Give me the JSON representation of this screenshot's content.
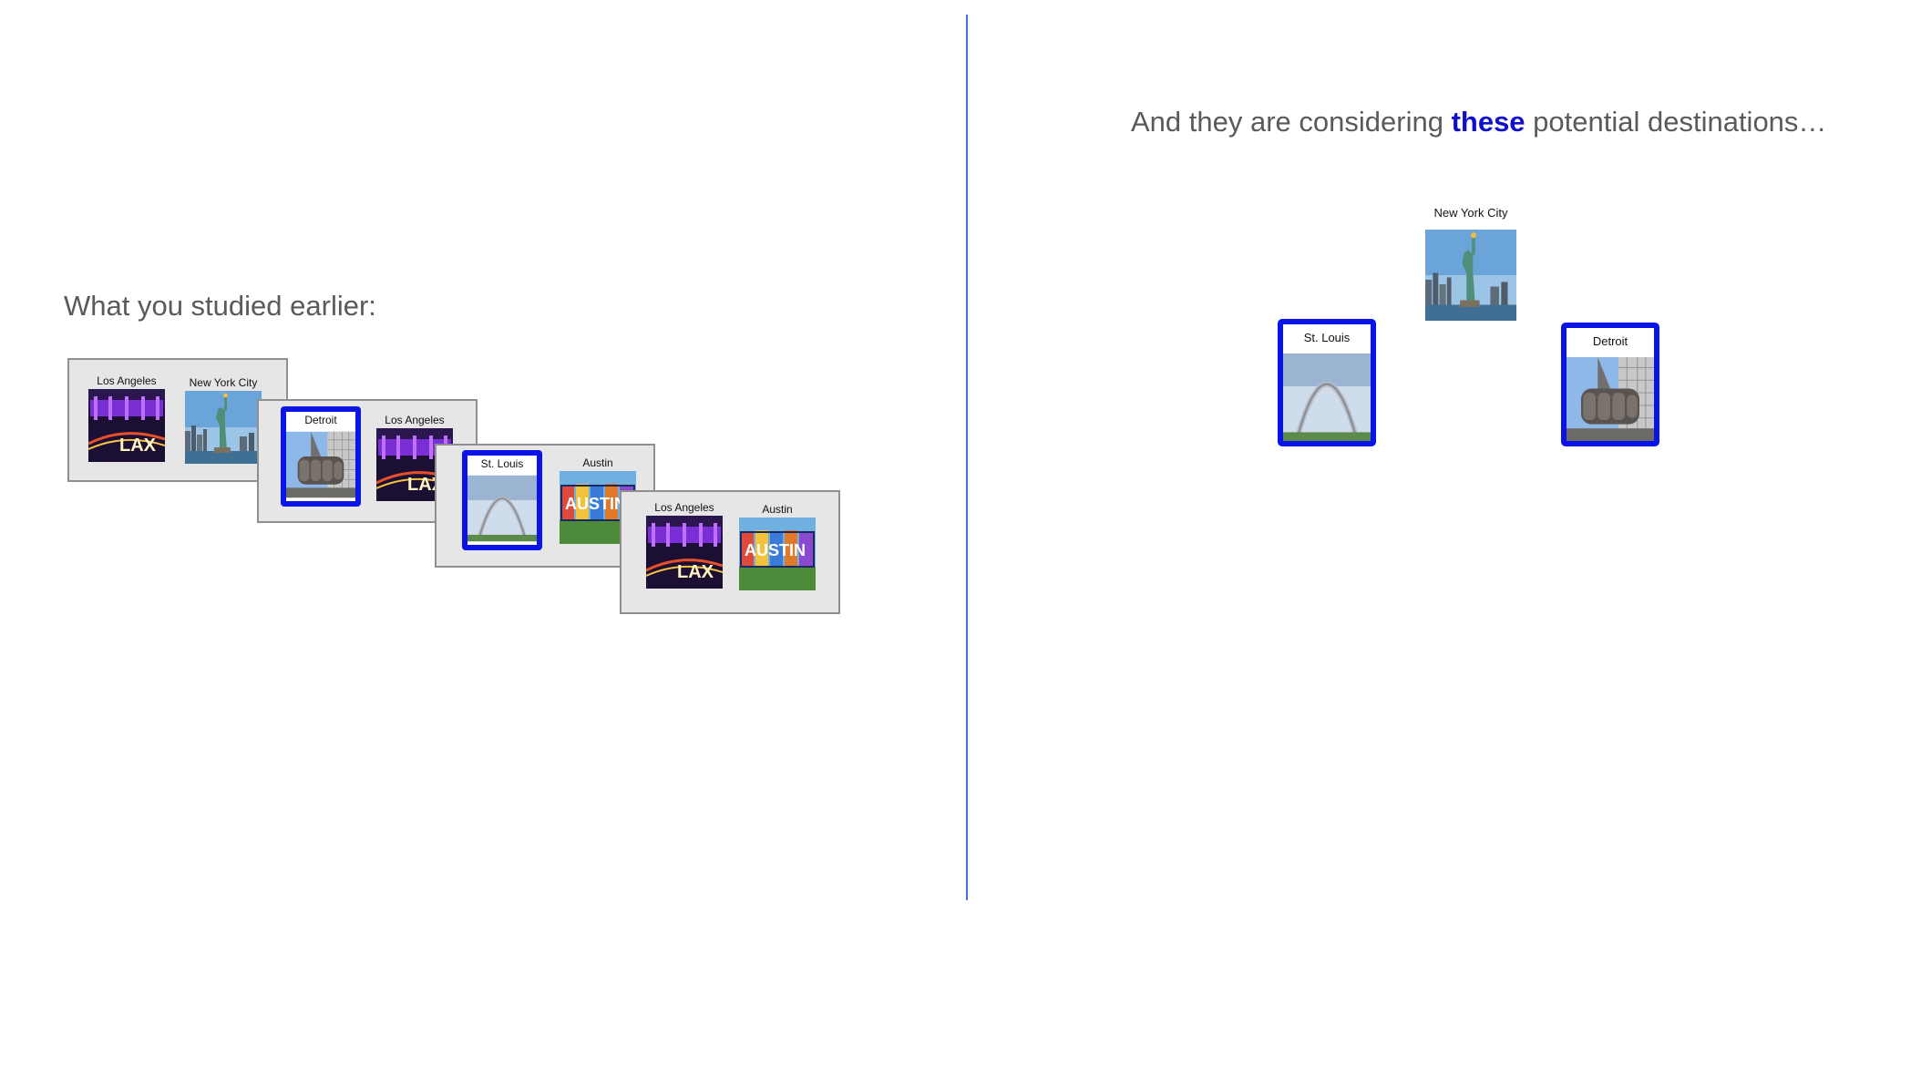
{
  "left": {
    "heading": "What you studied earlier:",
    "slides": [
      {
        "cards": [
          {
            "label": "Los Angeles",
            "image": "lax-sign-icon",
            "selected": false
          },
          {
            "label": "New York City",
            "image": "statue-of-liberty-icon",
            "selected": false
          }
        ]
      },
      {
        "cards": [
          {
            "label": "Detroit",
            "image": "detroit-fist-icon",
            "selected": true
          },
          {
            "label": "Los Angeles",
            "image": "lax-sign-icon",
            "selected": false
          }
        ]
      },
      {
        "cards": [
          {
            "label": "St. Louis",
            "image": "gateway-arch-icon",
            "selected": true
          },
          {
            "label": "Austin",
            "image": "austin-postcard-icon",
            "selected": false
          }
        ]
      },
      {
        "cards": [
          {
            "label": "Los Angeles",
            "image": "lax-sign-icon",
            "selected": false
          },
          {
            "label": "Austin",
            "image": "austin-postcard-icon",
            "selected": false
          }
        ]
      }
    ]
  },
  "right": {
    "heading_pre": "And they are considering ",
    "heading_emph": "these",
    "heading_post": " potential destinations…",
    "destinations": [
      {
        "label": "New York City",
        "image": "statue-of-liberty-icon",
        "selected": false
      },
      {
        "label": "St. Louis",
        "image": "gateway-arch-icon",
        "selected": true
      },
      {
        "label": "Detroit",
        "image": "detroit-fist-icon",
        "selected": true
      }
    ]
  },
  "colors": {
    "selection_border": "#0a14e6",
    "divider": "#4a6fd4",
    "emphasis": "#1010cc"
  }
}
